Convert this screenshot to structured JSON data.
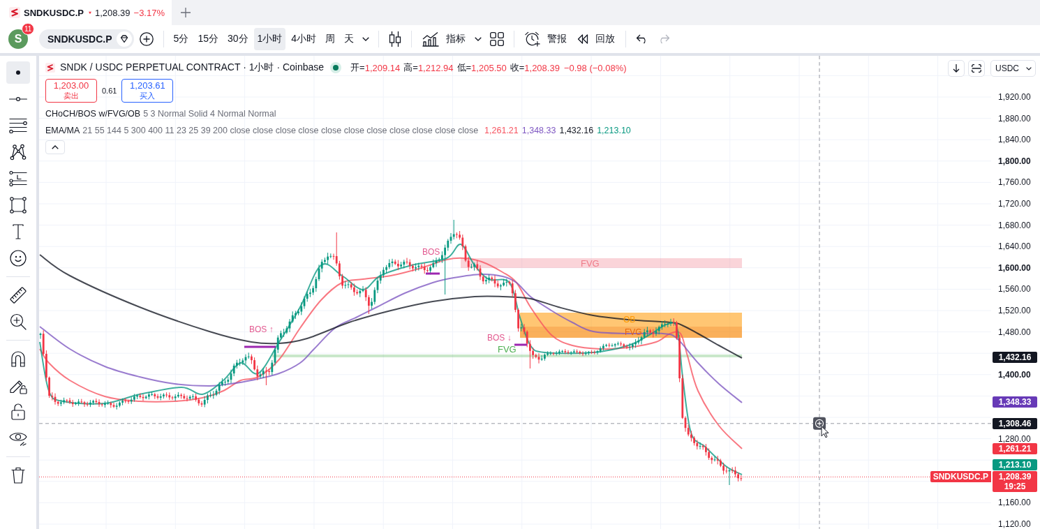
{
  "browser_tab": {
    "symbol": "SNDKUSDC.P",
    "price": "1,208.39",
    "change": "−3.17%"
  },
  "toolbar": {
    "avatar": "S",
    "notifications": "11",
    "symbol": "SNDKUSDC.P",
    "intervals": [
      {
        "label": "5分",
        "selected": false
      },
      {
        "label": "15分",
        "selected": false
      },
      {
        "label": "30分",
        "selected": false
      },
      {
        "label": "1小时",
        "selected": true
      },
      {
        "label": "4小时",
        "selected": false
      },
      {
        "label": "周",
        "selected": false
      },
      {
        "label": "天",
        "selected": false
      }
    ],
    "indicators": "指标",
    "alerts": "警报",
    "replay": "回放",
    "undo": {
      "disabled": false
    },
    "redo": {
      "disabled": true
    }
  },
  "drawing_tools": [
    [
      {
        "kind": "cursor",
        "selected": true
      },
      {
        "kind": "trend_line",
        "selected": false
      },
      {
        "kind": "fibonacci",
        "selected": false
      },
      {
        "kind": "pattern",
        "selected": false
      },
      {
        "kind": "projection",
        "selected": false
      },
      {
        "kind": "shapes",
        "selected": false
      },
      {
        "kind": "text",
        "selected": false
      },
      {
        "kind": "emoji",
        "selected": false
      }
    ],
    [
      {
        "kind": "measure",
        "selected": false
      },
      {
        "kind": "zoom",
        "selected": false
      }
    ],
    [
      {
        "kind": "magnet",
        "selected": false
      },
      {
        "kind": "stay_in_drawing",
        "selected": false
      },
      {
        "kind": "lock",
        "selected": false
      },
      {
        "kind": "hide",
        "selected": false
      }
    ],
    [
      {
        "kind": "remove",
        "selected": false
      }
    ]
  ],
  "legend": {
    "title": "SNDK / USDC PERPETUAL CONTRACT · 1小时 · Coinbase",
    "ohlc": [
      {
        "label": "开=",
        "value": "1,209.14"
      },
      {
        "label": "高=",
        "value": "1,212.94"
      },
      {
        "label": "低=",
        "value": "1,205.50"
      },
      {
        "label": "收=",
        "value": "1,208.39"
      }
    ],
    "change": "−0.98 (−0.08%)",
    "sell": {
      "price": "1,203.00",
      "label": "卖出"
    },
    "spread": "0.61",
    "buy": {
      "price": "1,203.61",
      "label": "买入"
    },
    "studies": [
      {
        "name": "CHoCH/BOS w/FVG/OB",
        "inputs": "5 3 Normal Solid 4 Normal Normal"
      },
      {
        "name": "EMA/MA",
        "inputs": "21 55 144 5 300 400 11 23 25 39 200 close close close close close close close close close close close",
        "values": [
          {
            "text": "1,261.21",
            "color": "#f7525f"
          },
          {
            "text": "1,348.33",
            "color": "#7e57c2"
          },
          {
            "text": "1,432.16",
            "color": "#131722"
          },
          {
            "text": "1,213.10",
            "color": "#089981"
          }
        ]
      }
    ]
  },
  "chart": {
    "zones": [
      {
        "label": "FVG",
        "color": "#ef7a88"
      },
      {
        "label": "OB",
        "color": "#ff9800"
      },
      {
        "label": "FVG",
        "color": "#e8650a"
      },
      {
        "label": "FVG",
        "color": "#4caf50"
      }
    ],
    "structure_breaks": [
      {
        "label": "BOS ↑"
      },
      {
        "label": "BOS"
      },
      {
        "label": "BOS ↓"
      }
    ]
  },
  "price_axis": {
    "currency": "USDC",
    "ticks": [
      {
        "label": "1,920.00",
        "major": false
      },
      {
        "label": "1,880.00",
        "major": false
      },
      {
        "label": "1,840.00",
        "major": false
      },
      {
        "label": "1,800.00",
        "major": true
      },
      {
        "label": "1,760.00",
        "major": false
      },
      {
        "label": "1,720.00",
        "major": false
      },
      {
        "label": "1,680.00",
        "major": false
      },
      {
        "label": "1,640.00",
        "major": false
      },
      {
        "label": "1,600.00",
        "major": true
      },
      {
        "label": "1,560.00",
        "major": false
      },
      {
        "label": "1,520.00",
        "major": false
      },
      {
        "label": "1,480.00",
        "major": false
      },
      {
        "label": "1,400.00",
        "major": true
      },
      {
        "label": "1,280.00",
        "major": false
      },
      {
        "label": "1,160.00",
        "major": false
      },
      {
        "label": "1,120.00",
        "major": false
      }
    ],
    "tags": [
      {
        "text": "1,432.16",
        "color": "#131722"
      },
      {
        "text": "1,348.33",
        "color": "#673ab7"
      },
      {
        "text": "1,261.21",
        "color": "#f23645"
      },
      {
        "text": "1,213.10",
        "color": "#089981"
      }
    ],
    "crosshair_price": "1,308.46",
    "last_price": {
      "symbol": "SNDKUSDC.P",
      "price": "1,208.39",
      "countdown": "19:25"
    }
  }
}
